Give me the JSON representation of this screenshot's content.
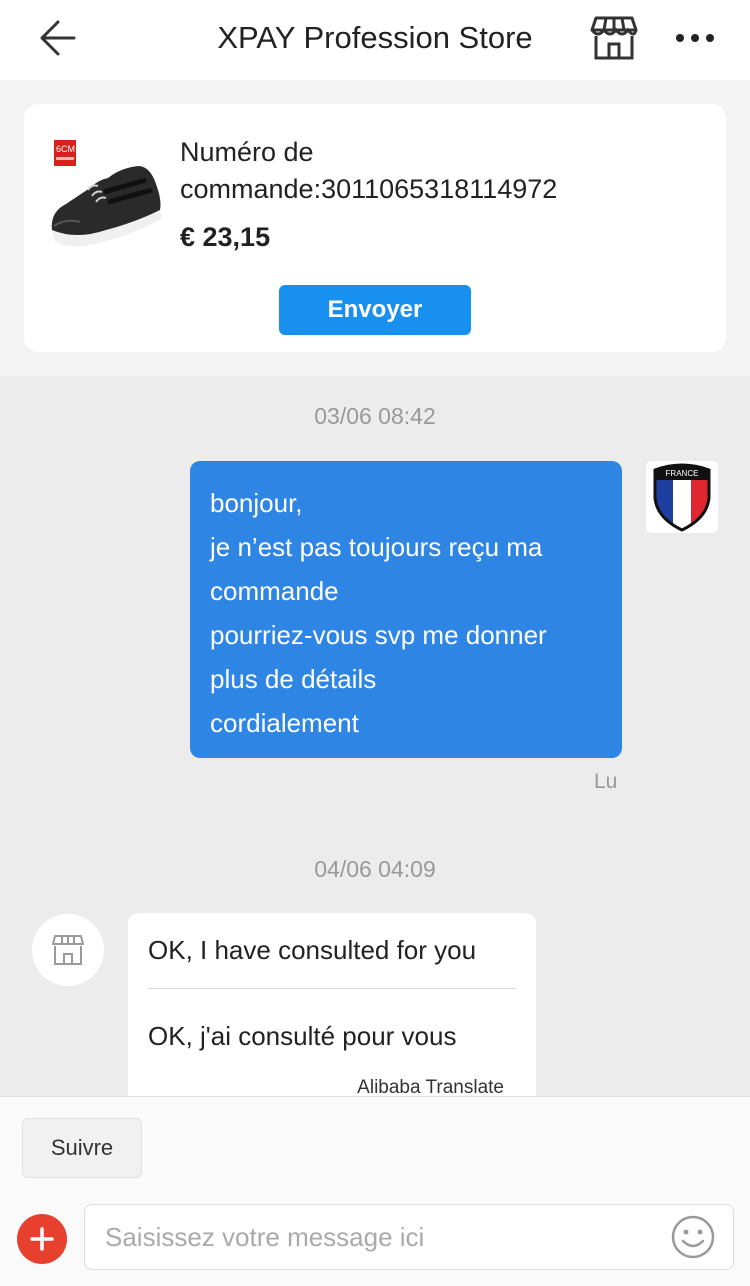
{
  "header": {
    "title": "XPAY Profession Store",
    "back_icon": "arrow-left-icon",
    "store_icon": "storefront-icon",
    "more_icon": "more-dots-icon"
  },
  "order_card": {
    "thumbnail_badge": "6CM",
    "order_number_text": "Numéro de commande:3011065318114972",
    "price": "€ 23,15",
    "send_label": "Envoyer"
  },
  "messages": {
    "first_timestamp": "03/06 08:42",
    "outgoing_lines": [
      "bonjour,",
      "je n’est pas toujours reçu ma",
      "commande",
      "pourriez-vous svp me donner",
      "plus de détails",
      "cordialement"
    ],
    "avatar_badge": "FRANCE",
    "read_status": "Lu",
    "second_timestamp": "04/06 04:09",
    "incoming_original": "OK, I have consulted for you",
    "incoming_translation": "OK, j'ai consulté pour vous",
    "translation_credit": "Alibaba Translate"
  },
  "bottom_bar": {
    "follow_label": "Suivre",
    "input_placeholder": "Saisissez votre message ici",
    "add_icon": "plus-icon",
    "emoji_icon": "smiley-icon"
  },
  "colors": {
    "accent_blue": "#1890f0",
    "bubble_blue": "#2e85e3",
    "add_red": "#e8402f"
  }
}
